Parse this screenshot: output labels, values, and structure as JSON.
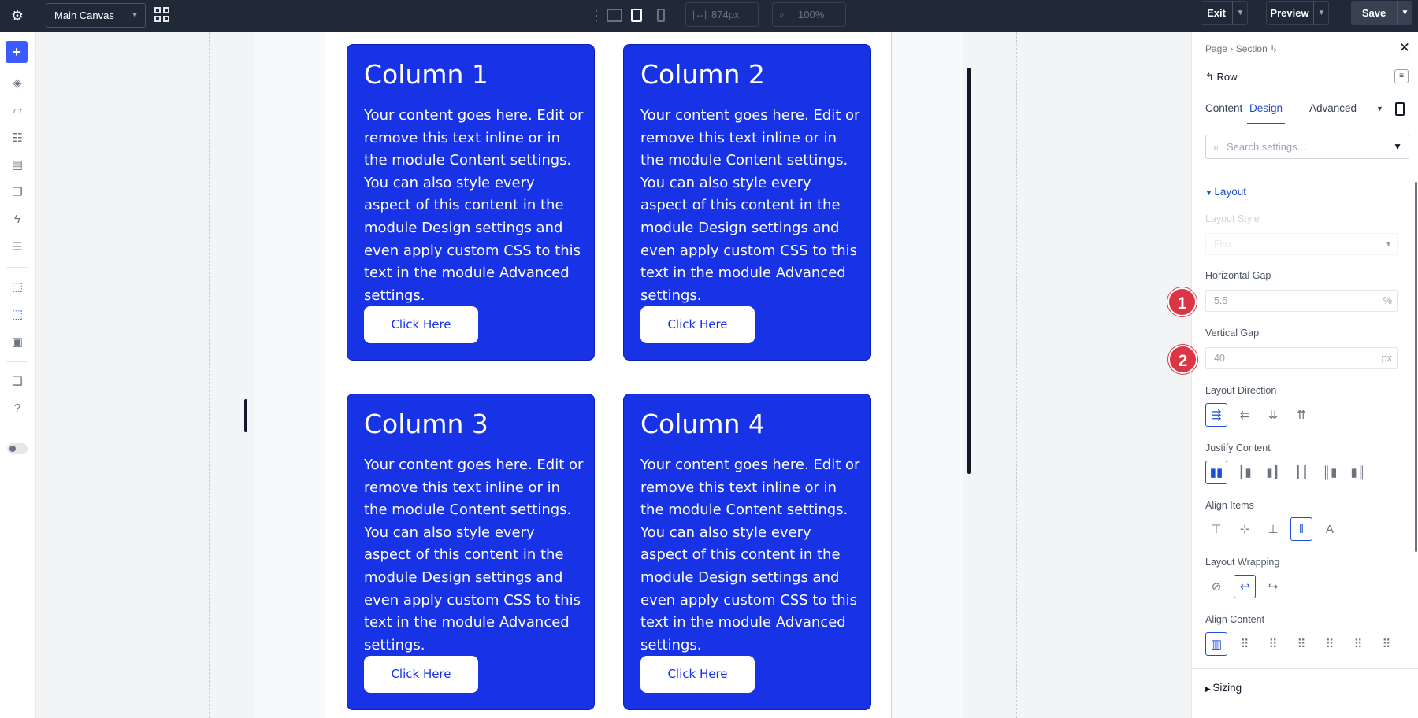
{
  "topbar": {
    "canvas_name": "Main Canvas",
    "width_value": "874px",
    "zoom_value": "100%",
    "exit_label": "Exit",
    "preview_label": "Preview",
    "save_label": "Save"
  },
  "columns": [
    {
      "title": "Column 1",
      "body": "Your content goes here. Edit or remove this text inline or in the module Content settings. You can also style every aspect of this content in the module Design settings and even apply custom CSS to this text in the module Advanced settings.",
      "button": "Click Here"
    },
    {
      "title": "Column 2",
      "body": "Your content goes here. Edit or remove this text inline or in the module Content settings. You can also style every aspect of this content in the module Design settings and even apply custom CSS to this text in the module Advanced settings.",
      "button": "Click Here"
    },
    {
      "title": "Column 3",
      "body": "Your content goes here. Edit or remove this text inline or in the module Content settings. You can also style every aspect of this content in the module Design settings and even apply custom CSS to this text in the module Advanced settings.",
      "button": "Click Here"
    },
    {
      "title": "Column 4",
      "body": "Your content goes here. Edit or remove this text inline or in the module Content settings. You can also style every aspect of this content in the module Design settings and even apply custom CSS to this text in the module Advanced settings.",
      "button": "Click Here"
    }
  ],
  "panel": {
    "breadcrumb": [
      "Page",
      "Section"
    ],
    "element_title": "Row",
    "tabs": [
      "Content",
      "Design",
      "Advanced"
    ],
    "active_tab": "Design",
    "search_placeholder": "Search settings...",
    "section_layout": "Layout",
    "layout_style_label": "Layout Style",
    "layout_style_value": "Flex",
    "horizontal_gap_label": "Horizontal Gap",
    "horizontal_gap_value": "5.5",
    "horizontal_gap_unit": "%",
    "vertical_gap_label": "Vertical Gap",
    "vertical_gap_value": "40",
    "vertical_gap_unit": "px",
    "layout_direction_label": "Layout Direction",
    "justify_content_label": "Justify Content",
    "align_items_label": "Align Items",
    "layout_wrapping_label": "Layout Wrapping",
    "align_content_label": "Align Content",
    "section_sizing": "Sizing"
  },
  "markers": [
    "1",
    "2"
  ],
  "colors": {
    "accent": "#1d4ed8",
    "column_bg": "#1833e6",
    "marker": "#dc3545",
    "topbar": "#1f2937"
  }
}
